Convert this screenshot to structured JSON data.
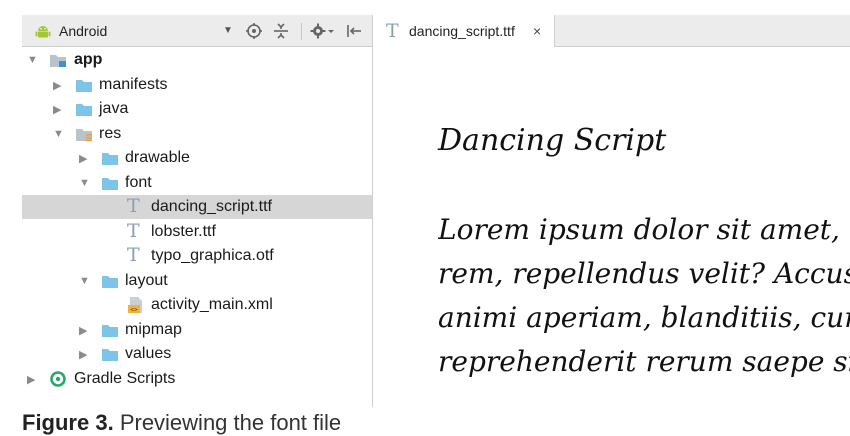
{
  "panel": {
    "view_selector": "Android",
    "tree": [
      {
        "label": "app",
        "depth": 0,
        "arrow": "expanded",
        "icon": "module-folder-icon",
        "bold": true
      },
      {
        "label": "manifests",
        "depth": 1,
        "arrow": "collapsed",
        "icon": "folder-icon"
      },
      {
        "label": "java",
        "depth": 1,
        "arrow": "collapsed",
        "icon": "folder-icon"
      },
      {
        "label": "res",
        "depth": 1,
        "arrow": "expanded",
        "icon": "res-folder-icon"
      },
      {
        "label": "drawable",
        "depth": 2,
        "arrow": "collapsed",
        "icon": "folder-icon"
      },
      {
        "label": "font",
        "depth": 2,
        "arrow": "expanded",
        "icon": "folder-icon"
      },
      {
        "label": "dancing_script.ttf",
        "depth": 3,
        "arrow": "none",
        "icon": "font-file-icon",
        "selected": true
      },
      {
        "label": "lobster.ttf",
        "depth": 3,
        "arrow": "none",
        "icon": "font-file-icon"
      },
      {
        "label": "typo_graphica.otf",
        "depth": 3,
        "arrow": "none",
        "icon": "font-file-icon"
      },
      {
        "label": "layout",
        "depth": 2,
        "arrow": "expanded",
        "icon": "folder-icon"
      },
      {
        "label": "activity_main.xml",
        "depth": 3,
        "arrow": "none",
        "icon": "xml-file-icon"
      },
      {
        "label": "mipmap",
        "depth": 2,
        "arrow": "collapsed",
        "icon": "folder-icon"
      },
      {
        "label": "values",
        "depth": 2,
        "arrow": "collapsed",
        "icon": "folder-icon"
      },
      {
        "label": "Gradle Scripts",
        "depth": 0,
        "arrow": "collapsed",
        "icon": "gradle-icon"
      }
    ]
  },
  "editor": {
    "tab_label": "dancing_script.ttf",
    "tab_close": "×",
    "preview_title": "Dancing Script",
    "preview_lines": [
      "Lorem ipsum dolor sit amet, cons",
      "rem, repellendus velit? Accusant",
      "animi aperiam, blanditiis, cum a",
      "reprehenderit rerum saepe sint s"
    ]
  },
  "caption": {
    "figure": "Figure 3.",
    "text": "Previewing the font file"
  },
  "colors": {
    "android_green": "#a4c639",
    "folder_blue": "#7cc4e8",
    "selection": "#d6d6d6",
    "toolbar_bg": "#ececec"
  }
}
